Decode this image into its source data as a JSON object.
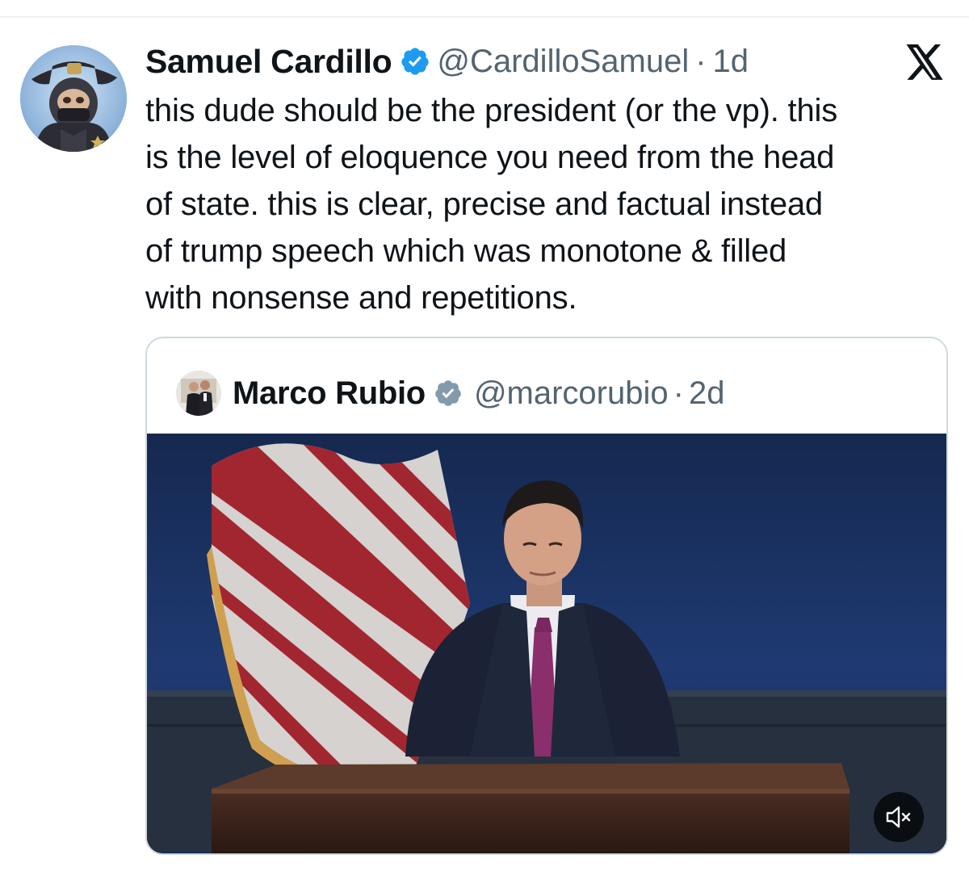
{
  "tweet": {
    "author": {
      "display_name": "Samuel Cardillo",
      "handle": "@CardilloSamuel",
      "verified_icon": "verified-badge-icon"
    },
    "separator": "·",
    "time": "1d",
    "text": "this dude should be the president (or the vp). this\nis the level of eloquence you need from the head\nof state. this is clear, precise and factual instead\nof trump speech which was monotone & filled\nwith nonsense and repetitions.",
    "platform_icon": "x-logo-icon"
  },
  "quoted_tweet": {
    "author": {
      "display_name": "Marco Rubio",
      "handle": "@marcorubio",
      "verified_icon": "verified-badge-icon"
    },
    "separator": "·",
    "time": "2d",
    "media": {
      "type": "video",
      "mute_icon": "volume-muted-icon"
    }
  },
  "colors": {
    "text_primary": "#0f1419",
    "text_secondary": "#536471",
    "verified_blue": "#1d9bf0",
    "verified_gray": "#829aab",
    "border": "#cfd9de",
    "video_background": "#1c3260"
  }
}
